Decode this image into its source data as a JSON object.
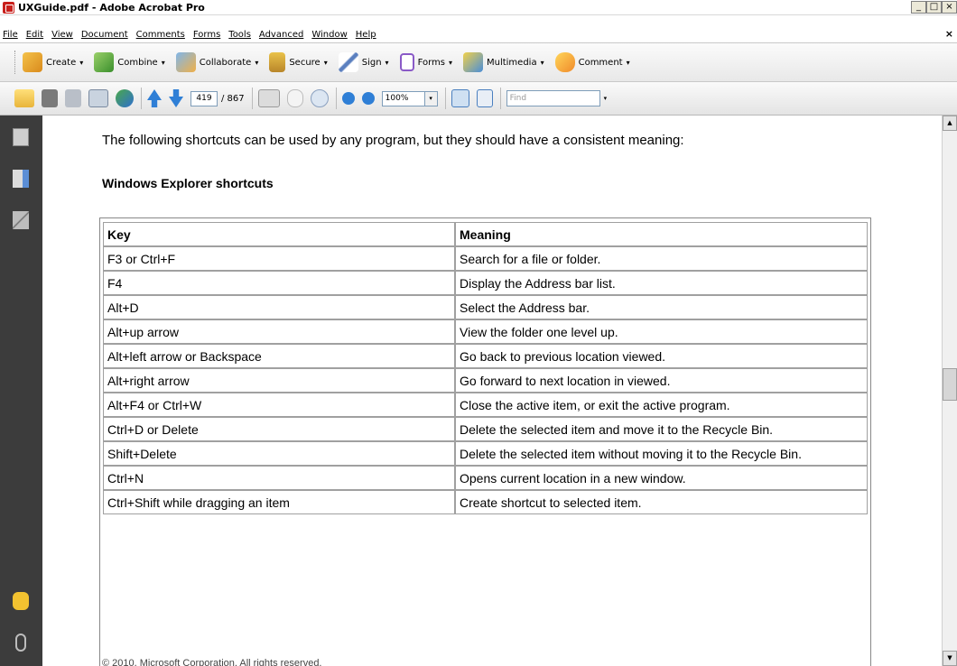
{
  "window": {
    "title": "UXGuide.pdf - Adobe Acrobat Pro",
    "controls": [
      "_",
      "□",
      "×"
    ]
  },
  "menu": {
    "items": [
      "File",
      "Edit",
      "View",
      "Document",
      "Comments",
      "Forms",
      "Tools",
      "Advanced",
      "Window",
      "Help"
    ],
    "close": "×"
  },
  "tasks": {
    "create": "Create",
    "combine": "Combine",
    "collaborate": "Collaborate",
    "secure": "Secure",
    "sign": "Sign",
    "forms": "Forms",
    "multimedia": "Multimedia",
    "comment": "Comment",
    "arrow": "▾"
  },
  "nav": {
    "page_current": "419",
    "page_total": "/ 867",
    "zoom": "100%",
    "find_placeholder": "Find",
    "dropdown_arrow": "▾"
  },
  "document": {
    "intro": "The following shortcuts can be used by any program, but they should have a consistent meaning:",
    "heading": "Windows Explorer shortcuts",
    "table": {
      "headers": {
        "key": "Key",
        "meaning": "Meaning"
      },
      "rows": [
        {
          "key": "F3 or Ctrl+F",
          "meaning": "Search for a file or folder."
        },
        {
          "key": "F4",
          "meaning": "Display the Address bar list."
        },
        {
          "key": "Alt+D",
          "meaning": "Select the Address bar."
        },
        {
          "key": "Alt+up arrow",
          "meaning": "View the folder one level up."
        },
        {
          "key": "Alt+left arrow or Backspace",
          "meaning": "Go back to previous location viewed."
        },
        {
          "key": "Alt+right arrow",
          "meaning": "Go forward to next location in viewed."
        },
        {
          "key": "Alt+F4 or Ctrl+W",
          "meaning": "Close the active item, or exit the active program."
        },
        {
          "key": "Ctrl+D or Delete",
          "meaning": "Delete the selected item and move it to the Recycle Bin."
        },
        {
          "key": "Shift+Delete",
          "meaning": "Delete the selected item without moving it to the Recycle Bin."
        },
        {
          "key": "Ctrl+N",
          "meaning": "Opens current location in a new window."
        },
        {
          "key": "Ctrl+Shift while dragging an item",
          "meaning": "Create shortcut to selected item."
        }
      ]
    },
    "footer": "© 2010, Microsoft Corporation. All rights reserved."
  },
  "icons": {
    "pages": "pages-icon",
    "bookmarks": "bookmarks-icon",
    "signatures": "signatures-icon",
    "comments": "comments-icon",
    "attachments": "attachments-icon"
  },
  "colors": {
    "nav_panel": "#3c3c3c",
    "title_icon": "#c8201c",
    "accent_blue": "#2f7fd6"
  }
}
